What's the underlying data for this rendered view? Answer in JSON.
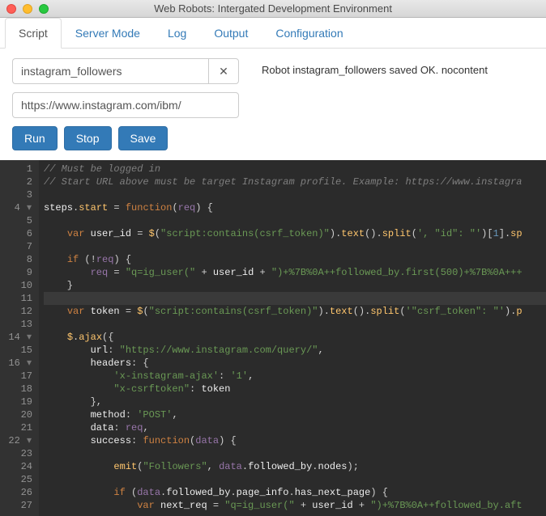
{
  "window": {
    "title": "Web Robots: Intergated Development Environment"
  },
  "tabs": [
    {
      "label": "Script",
      "active": true
    },
    {
      "label": "Server Mode",
      "active": false
    },
    {
      "label": "Log",
      "active": false
    },
    {
      "label": "Output",
      "active": false
    },
    {
      "label": "Configuration",
      "active": false
    }
  ],
  "status": "Robot instagram_followers saved OK. nocontent",
  "fields": {
    "robot_name": "instagram_followers",
    "start_url": "https://www.instagram.com/ibm/"
  },
  "buttons": {
    "run": "Run",
    "stop": "Stop",
    "save": "Save"
  },
  "icons": {
    "clear": "✕"
  },
  "colors": {
    "primary": "#337ab7",
    "editor_bg": "#2b2b2b"
  },
  "editor": {
    "line_numbers": [
      1,
      2,
      3,
      4,
      5,
      6,
      7,
      8,
      9,
      10,
      11,
      12,
      13,
      14,
      15,
      16,
      17,
      18,
      19,
      20,
      21,
      22,
      23,
      24,
      25,
      26,
      27
    ],
    "fold_markers": {
      "4": "▾",
      "14": "▾",
      "16": "▾",
      "22": "▾"
    },
    "highlighted_line": 11,
    "code_lines": [
      {
        "tokens": [
          {
            "c": "cm",
            "t": "// Must be logged in"
          }
        ]
      },
      {
        "tokens": [
          {
            "c": "cm",
            "t": "// Start URL above must be target Instagram profile. Example: https://www.instagra"
          }
        ]
      },
      {
        "tokens": []
      },
      {
        "tokens": [
          {
            "c": "id",
            "t": "steps"
          },
          {
            "c": "op",
            "t": "."
          },
          {
            "c": "fn",
            "t": "start"
          },
          {
            "c": "op",
            "t": " = "
          },
          {
            "c": "kw",
            "t": "function"
          },
          {
            "c": "op",
            "t": "("
          },
          {
            "c": "var",
            "t": "req"
          },
          {
            "c": "op",
            "t": ") {"
          }
        ]
      },
      {
        "tokens": []
      },
      {
        "tokens": [
          {
            "c": "op",
            "t": "    "
          },
          {
            "c": "kw",
            "t": "var"
          },
          {
            "c": "id",
            "t": " user_id "
          },
          {
            "c": "op",
            "t": "= "
          },
          {
            "c": "fn",
            "t": "$"
          },
          {
            "c": "op",
            "t": "("
          },
          {
            "c": "str",
            "t": "\"script:contains(csrf_token)\""
          },
          {
            "c": "op",
            "t": ")."
          },
          {
            "c": "fn",
            "t": "text"
          },
          {
            "c": "op",
            "t": "()."
          },
          {
            "c": "fn",
            "t": "split"
          },
          {
            "c": "op",
            "t": "("
          },
          {
            "c": "str",
            "t": "', \"id\": \"'"
          },
          {
            "c": "op",
            "t": ")["
          },
          {
            "c": "num",
            "t": "1"
          },
          {
            "c": "op",
            "t": "]."
          },
          {
            "c": "fn",
            "t": "sp"
          }
        ]
      },
      {
        "tokens": []
      },
      {
        "tokens": [
          {
            "c": "op",
            "t": "    "
          },
          {
            "c": "kw",
            "t": "if"
          },
          {
            "c": "op",
            "t": " (!"
          },
          {
            "c": "var",
            "t": "req"
          },
          {
            "c": "op",
            "t": ") {"
          }
        ]
      },
      {
        "tokens": [
          {
            "c": "op",
            "t": "        "
          },
          {
            "c": "var",
            "t": "req"
          },
          {
            "c": "op",
            "t": " = "
          },
          {
            "c": "str",
            "t": "\"q=ig_user(\""
          },
          {
            "c": "op",
            "t": " + "
          },
          {
            "c": "id",
            "t": "user_id"
          },
          {
            "c": "op",
            "t": " + "
          },
          {
            "c": "str",
            "t": "\")+%7B%0A++followed_by.first(500)+%7B%0A+++"
          }
        ]
      },
      {
        "tokens": [
          {
            "c": "op",
            "t": "    }"
          }
        ]
      },
      {
        "tokens": []
      },
      {
        "tokens": [
          {
            "c": "op",
            "t": "    "
          },
          {
            "c": "kw",
            "t": "var"
          },
          {
            "c": "id",
            "t": " token "
          },
          {
            "c": "op",
            "t": "= "
          },
          {
            "c": "fn",
            "t": "$"
          },
          {
            "c": "op",
            "t": "("
          },
          {
            "c": "str",
            "t": "\"script:contains(csrf_token)\""
          },
          {
            "c": "op",
            "t": ")."
          },
          {
            "c": "fn",
            "t": "text"
          },
          {
            "c": "op",
            "t": "()."
          },
          {
            "c": "fn",
            "t": "split"
          },
          {
            "c": "op",
            "t": "("
          },
          {
            "c": "str",
            "t": "'\"csrf_token\": \"'"
          },
          {
            "c": "op",
            "t": ")."
          },
          {
            "c": "fn",
            "t": "p"
          }
        ]
      },
      {
        "tokens": []
      },
      {
        "tokens": [
          {
            "c": "op",
            "t": "    "
          },
          {
            "c": "fn",
            "t": "$"
          },
          {
            "c": "op",
            "t": "."
          },
          {
            "c": "fn",
            "t": "ajax"
          },
          {
            "c": "op",
            "t": "({"
          }
        ]
      },
      {
        "tokens": [
          {
            "c": "op",
            "t": "        "
          },
          {
            "c": "id",
            "t": "url"
          },
          {
            "c": "op",
            "t": ": "
          },
          {
            "c": "str",
            "t": "\"https://www.instagram.com/query/\""
          },
          {
            "c": "op",
            "t": ","
          }
        ]
      },
      {
        "tokens": [
          {
            "c": "op",
            "t": "        "
          },
          {
            "c": "id",
            "t": "headers"
          },
          {
            "c": "op",
            "t": ": {"
          }
        ]
      },
      {
        "tokens": [
          {
            "c": "op",
            "t": "            "
          },
          {
            "c": "str",
            "t": "'x-instagram-ajax'"
          },
          {
            "c": "op",
            "t": ": "
          },
          {
            "c": "str",
            "t": "'1'"
          },
          {
            "c": "op",
            "t": ","
          }
        ]
      },
      {
        "tokens": [
          {
            "c": "op",
            "t": "            "
          },
          {
            "c": "str",
            "t": "\"x-csrftoken\""
          },
          {
            "c": "op",
            "t": ": "
          },
          {
            "c": "id",
            "t": "token"
          }
        ]
      },
      {
        "tokens": [
          {
            "c": "op",
            "t": "        },"
          }
        ]
      },
      {
        "tokens": [
          {
            "c": "op",
            "t": "        "
          },
          {
            "c": "id",
            "t": "method"
          },
          {
            "c": "op",
            "t": ": "
          },
          {
            "c": "str",
            "t": "'POST'"
          },
          {
            "c": "op",
            "t": ","
          }
        ]
      },
      {
        "tokens": [
          {
            "c": "op",
            "t": "        "
          },
          {
            "c": "id",
            "t": "data"
          },
          {
            "c": "op",
            "t": ": "
          },
          {
            "c": "var",
            "t": "req"
          },
          {
            "c": "op",
            "t": ","
          }
        ]
      },
      {
        "tokens": [
          {
            "c": "op",
            "t": "        "
          },
          {
            "c": "id",
            "t": "success"
          },
          {
            "c": "op",
            "t": ": "
          },
          {
            "c": "kw",
            "t": "function"
          },
          {
            "c": "op",
            "t": "("
          },
          {
            "c": "var",
            "t": "data"
          },
          {
            "c": "op",
            "t": ") {"
          }
        ]
      },
      {
        "tokens": []
      },
      {
        "tokens": [
          {
            "c": "op",
            "t": "            "
          },
          {
            "c": "fn",
            "t": "emit"
          },
          {
            "c": "op",
            "t": "("
          },
          {
            "c": "str",
            "t": "\"Followers\""
          },
          {
            "c": "op",
            "t": ", "
          },
          {
            "c": "var",
            "t": "data"
          },
          {
            "c": "op",
            "t": "."
          },
          {
            "c": "id",
            "t": "followed_by"
          },
          {
            "c": "op",
            "t": "."
          },
          {
            "c": "id",
            "t": "nodes"
          },
          {
            "c": "op",
            "t": ");"
          }
        ]
      },
      {
        "tokens": []
      },
      {
        "tokens": [
          {
            "c": "op",
            "t": "            "
          },
          {
            "c": "kw",
            "t": "if"
          },
          {
            "c": "op",
            "t": " ("
          },
          {
            "c": "var",
            "t": "data"
          },
          {
            "c": "op",
            "t": "."
          },
          {
            "c": "id",
            "t": "followed_by"
          },
          {
            "c": "op",
            "t": "."
          },
          {
            "c": "id",
            "t": "page_info"
          },
          {
            "c": "op",
            "t": "."
          },
          {
            "c": "id",
            "t": "has_next_page"
          },
          {
            "c": "op",
            "t": ") {"
          }
        ]
      },
      {
        "tokens": [
          {
            "c": "op",
            "t": "                "
          },
          {
            "c": "kw",
            "t": "var"
          },
          {
            "c": "id",
            "t": " next_req "
          },
          {
            "c": "op",
            "t": "= "
          },
          {
            "c": "str",
            "t": "\"q=ig_user(\""
          },
          {
            "c": "op",
            "t": " + "
          },
          {
            "c": "id",
            "t": "user_id"
          },
          {
            "c": "op",
            "t": " + "
          },
          {
            "c": "str",
            "t": "\")+%7B%0A++followed_by.aft"
          }
        ]
      }
    ]
  }
}
